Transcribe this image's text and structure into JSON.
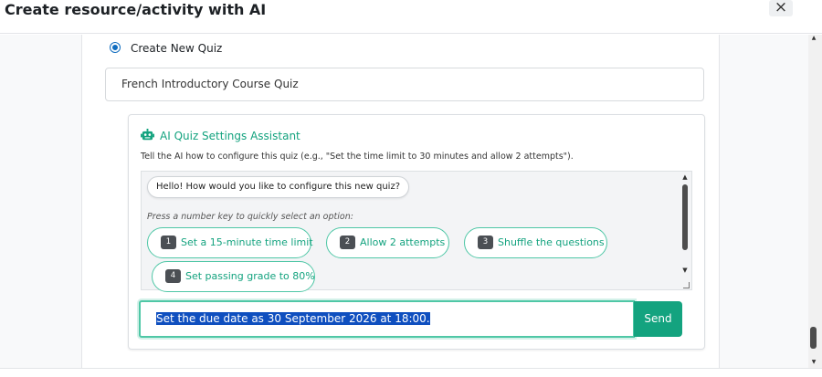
{
  "dialog": {
    "title": "Create resource/activity with AI",
    "close_icon": "×"
  },
  "mode": {
    "selected_option_label": "Create New Quiz"
  },
  "quiz_name": {
    "value": "French Introductory Course Quiz"
  },
  "assistant": {
    "title": "AI Quiz Settings Assistant",
    "helper_text": "Tell the AI how to configure this quiz (e.g., \"Set the time limit to 30 minutes and allow 2 attempts\").",
    "greeting": "Hello! How would you like to configure this new quiz?",
    "hint": "Press a number key to quickly select an option:",
    "options": [
      {
        "key": "1",
        "label": "Set a 15-minute time limit"
      },
      {
        "key": "2",
        "label": "Allow 2 attempts"
      },
      {
        "key": "3",
        "label": "Shuffle the questions"
      },
      {
        "key": "4",
        "label": "Set passing grade to 80%"
      }
    ],
    "message_input": "Set the due date as 30 September 2026 at 18:00.",
    "send_label": "Send"
  },
  "colors": {
    "accent": "#14a37f",
    "accent_border": "#4fc7a6",
    "radio": "#0f6cbf",
    "selection": "#0f4fbf"
  }
}
